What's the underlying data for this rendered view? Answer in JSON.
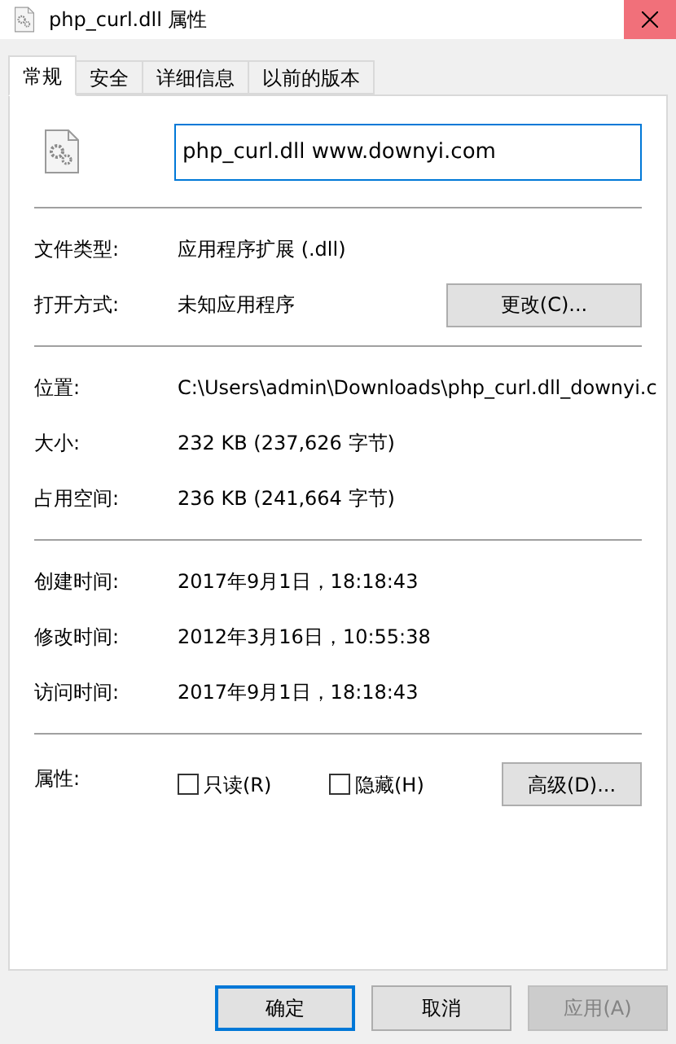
{
  "window": {
    "title": "php_curl.dll 属性"
  },
  "tabs": [
    {
      "label": "常规",
      "selected": true
    },
    {
      "label": "安全",
      "selected": false
    },
    {
      "label": "详细信息",
      "selected": false
    },
    {
      "label": "以前的版本",
      "selected": false
    }
  ],
  "file_name": {
    "value": "php_curl.dll www.downyi.com"
  },
  "groups": [
    {
      "rows": [
        {
          "label": "文件类型:",
          "value": "应用程序扩展 (.dll)"
        },
        {
          "label": "打开方式:",
          "value": "未知应用程序",
          "button": "更改(C)..."
        }
      ]
    },
    {
      "rows": [
        {
          "label": "位置:",
          "value": "C:\\Users\\admin\\Downloads\\php_curl.dll_downyi.c"
        },
        {
          "label": "大小:",
          "value": "232 KB (237,626 字节)"
        },
        {
          "label": "占用空间:",
          "value": "236 KB (241,664 字节)"
        }
      ]
    },
    {
      "rows": [
        {
          "label": "创建时间:",
          "value": "2017年9月1日，18:18:43"
        },
        {
          "label": "修改时间:",
          "value": "2012年3月16日，10:55:38"
        },
        {
          "label": "访问时间:",
          "value": "2017年9月1日，18:18:43"
        }
      ]
    }
  ],
  "attributes": {
    "label": "属性:",
    "checkboxes": [
      {
        "label": "只读(R)",
        "checked": false
      },
      {
        "label": "隐藏(H)",
        "checked": false
      }
    ],
    "button": "高级(D)..."
  },
  "buttons": [
    {
      "label": "确定",
      "default": true,
      "disabled": false
    },
    {
      "label": "取消",
      "default": false,
      "disabled": false
    },
    {
      "label": "应用(A)",
      "default": false,
      "disabled": true
    }
  ]
}
